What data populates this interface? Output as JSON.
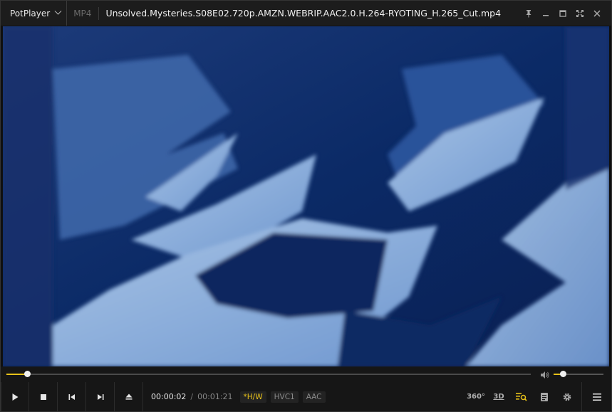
{
  "titlebar": {
    "app_name": "PotPlayer",
    "format": "MP4",
    "file_title": "Unsolved.Mysteries.S08E02.720p.AMZN.WEBRIP.AAC2.0.H.264-RYOTING_H.265_Cut.mp4",
    "controls": [
      "pin-icon",
      "minimize-icon",
      "maximize-icon",
      "fullscreen-icon",
      "close-icon"
    ]
  },
  "playback": {
    "current_time": "00:00:02",
    "separator": "/",
    "duration": "00:01:21",
    "progress_fraction": 0.039,
    "volume_fraction": 0.18
  },
  "tags": {
    "hw": "*H/W",
    "video_codec": "HVC1",
    "audio_codec": "AAC"
  },
  "right_controls": {
    "vr": "360°",
    "threed": "3D"
  },
  "colors": {
    "accent": "#e8c21a",
    "background": "#161616",
    "titlebar": "#1c1c1c"
  }
}
